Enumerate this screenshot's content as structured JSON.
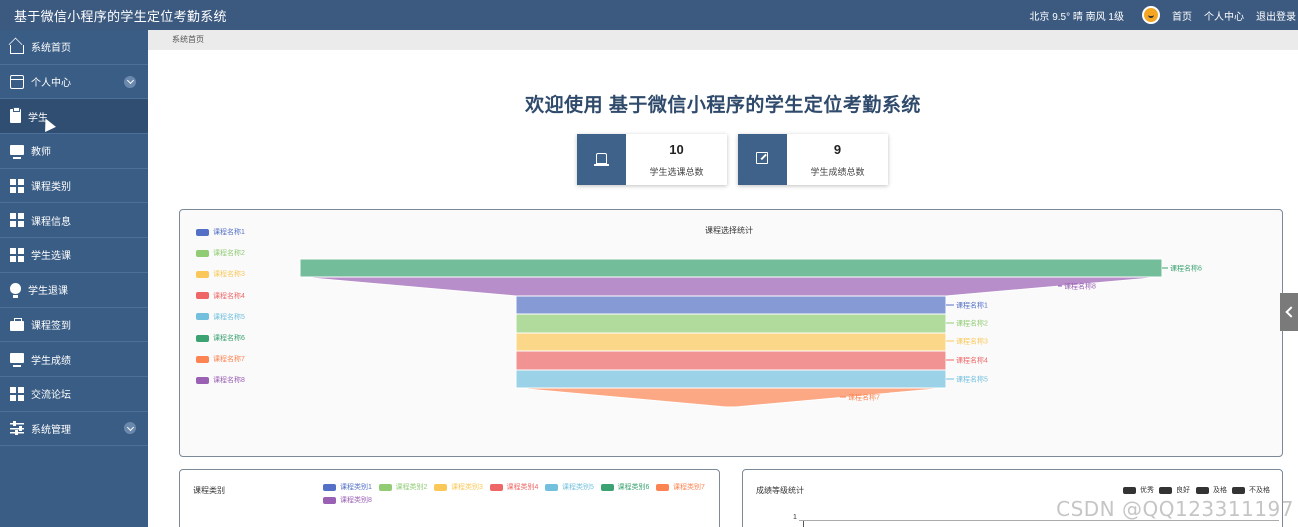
{
  "app": {
    "title": "基于微信小程序的学生定位考勤系统"
  },
  "topbar": {
    "weather": "北京  9.5°  晴  南风  1级",
    "links": [
      "首页",
      "个人中心",
      "退出登录"
    ]
  },
  "sidebar": {
    "items": [
      {
        "label": "系统首页",
        "icon": "home-icon"
      },
      {
        "label": "个人中心",
        "icon": "window-icon",
        "expandable": true
      },
      {
        "label": "学生",
        "icon": "clipboard-icon",
        "active": true
      },
      {
        "label": "教师",
        "icon": "monitor-icon"
      },
      {
        "label": "课程类别",
        "icon": "grid-icon"
      },
      {
        "label": "课程信息",
        "icon": "grid-icon"
      },
      {
        "label": "学生选课",
        "icon": "grid-icon"
      },
      {
        "label": "学生退课",
        "icon": "bulb-icon"
      },
      {
        "label": "课程签到",
        "icon": "briefcase-icon"
      },
      {
        "label": "学生成绩",
        "icon": "monitor-icon"
      },
      {
        "label": "交流论坛",
        "icon": "grid-icon"
      },
      {
        "label": "系统管理",
        "icon": "sliders-icon",
        "expandable": true
      }
    ]
  },
  "breadcrumb": "系统首页",
  "main": {
    "welcome": "欢迎使用 基于微信小程序的学生定位考勤系统",
    "stats": [
      {
        "value": "10",
        "label": "学生选课总数",
        "icon": "stamp-icon"
      },
      {
        "value": "9",
        "label": "学生成绩总数",
        "icon": "edit-icon"
      }
    ]
  },
  "colors": {
    "sidebar": "#3a5d85",
    "topbar": "#3c5a80",
    "accent": "#3f628a",
    "palette": [
      "#5470c6",
      "#91cc75",
      "#fac858",
      "#ee6666",
      "#73c0de",
      "#3ba272",
      "#fc8452",
      "#9a60b4"
    ]
  },
  "funnel_chart": {
    "title": "课程选择统计",
    "legend": [
      "课程名称1",
      "课程名称2",
      "课程名称3",
      "课程名称4",
      "课程名称5",
      "课程名称6",
      "课程名称7",
      "课程名称8"
    ],
    "layers": [
      {
        "label": "课程名称6",
        "color": "#3ba272"
      },
      {
        "label": "课程名称8",
        "color": "#9a60b4"
      },
      {
        "label": "课程名称1",
        "color": "#5470c6"
      },
      {
        "label": "课程名称2",
        "color": "#91cc75"
      },
      {
        "label": "课程名称3",
        "color": "#fac858"
      },
      {
        "label": "课程名称4",
        "color": "#ee6666"
      },
      {
        "label": "课程名称5",
        "color": "#73c0de"
      },
      {
        "label": "课程名称7",
        "color": "#fc8452"
      }
    ]
  },
  "category_chart": {
    "title": "课程类别",
    "legend": [
      "课程类别1",
      "课程类别2",
      "课程类别3",
      "课程类别4",
      "课程类别5",
      "课程类别6",
      "课程类别7",
      "课程类别8"
    ]
  },
  "grade_chart": {
    "title": "成绩等级统计",
    "legend": [
      "优秀",
      "良好",
      "及格",
      "不及格"
    ],
    "y_tick_top": "1"
  },
  "watermark": "CSDN @QQ123311197"
}
